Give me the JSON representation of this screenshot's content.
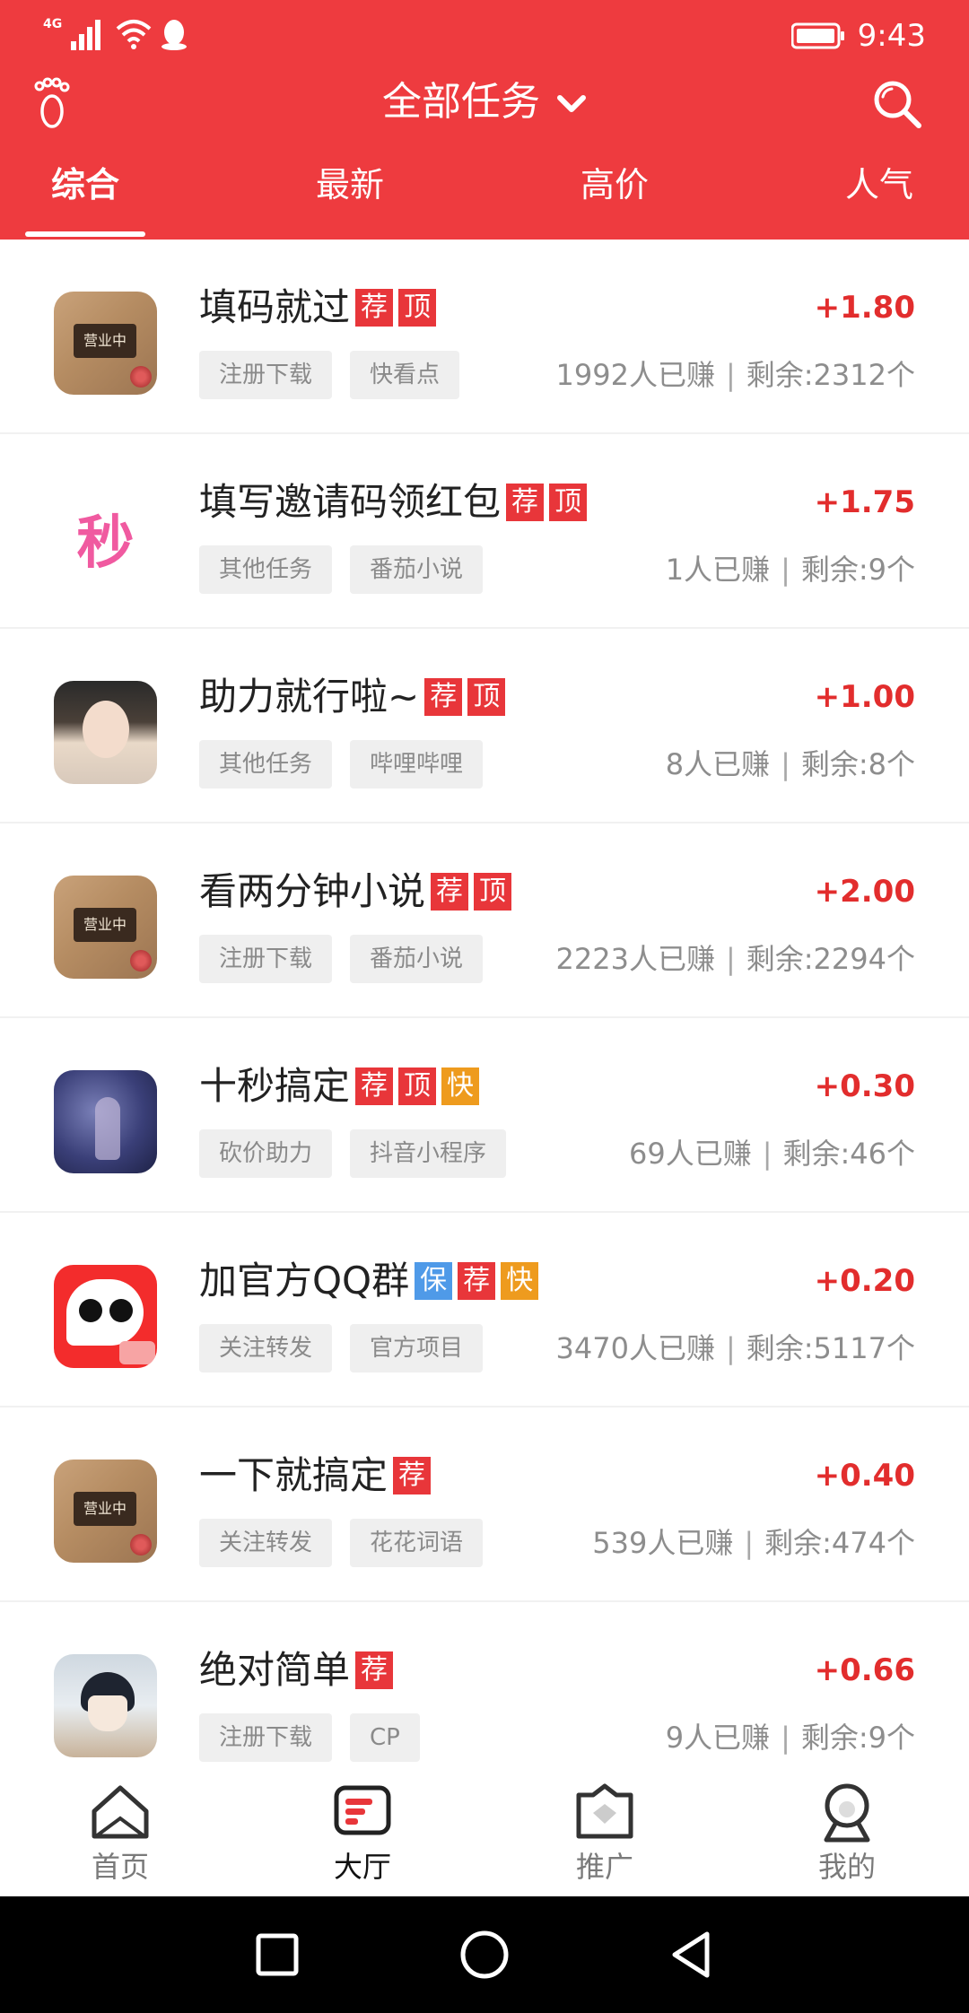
{
  "status_bar": {
    "network": "4G",
    "time": "9:43"
  },
  "header": {
    "title": "全部任务"
  },
  "tabs": [
    {
      "label": "综合",
      "active": true
    },
    {
      "label": "最新",
      "active": false
    },
    {
      "label": "高价",
      "active": false
    },
    {
      "label": "人气",
      "active": false
    }
  ],
  "tasks": [
    {
      "title": "填码就过",
      "badges": [
        "荐",
        "顶"
      ],
      "tags": [
        "注册下载",
        "快看点"
      ],
      "reward": "+1.80",
      "earned": "1992人已赚",
      "remaining": "剩余:2312个",
      "avatar_sign": "营业中"
    },
    {
      "title": "填写邀请码领红包",
      "badges": [
        "荐",
        "顶"
      ],
      "tags": [
        "其他任务",
        "番茄小说"
      ],
      "reward": "+1.75",
      "earned": "1人已赚",
      "remaining": "剩余:9个",
      "avatar_text": "秒"
    },
    {
      "title": "助力就行啦~",
      "badges": [
        "荐",
        "顶"
      ],
      "tags": [
        "其他任务",
        "哔哩哔哩"
      ],
      "reward": "+1.00",
      "earned": "8人已赚",
      "remaining": "剩余:8个"
    },
    {
      "title": "看两分钟小说",
      "badges": [
        "荐",
        "顶"
      ],
      "tags": [
        "注册下载",
        "番茄小说"
      ],
      "reward": "+2.00",
      "earned": "2223人已赚",
      "remaining": "剩余:2294个",
      "avatar_sign": "营业中"
    },
    {
      "title": "十秒搞定",
      "badges": [
        "荐",
        "顶",
        "快"
      ],
      "tags": [
        "砍价助力",
        "抖音小程序"
      ],
      "reward": "+0.30",
      "earned": "69人已赚",
      "remaining": "剩余:46个"
    },
    {
      "title": "加官方QQ群",
      "badges": [
        "保",
        "荐",
        "快"
      ],
      "tags": [
        "关注转发",
        "官方项目"
      ],
      "reward": "+0.20",
      "earned": "3470人已赚",
      "remaining": "剩余:5117个"
    },
    {
      "title": "一下就搞定",
      "badges": [
        "荐"
      ],
      "tags": [
        "关注转发",
        "花花词语"
      ],
      "reward": "+0.40",
      "earned": "539人已赚",
      "remaining": "剩余:474个",
      "avatar_sign": "营业中"
    },
    {
      "title": "绝对简单",
      "badges": [
        "荐"
      ],
      "tags": [
        "注册下载",
        "CP"
      ],
      "reward": "+0.66",
      "earned": "9人已赚",
      "remaining": "剩余:9个"
    }
  ],
  "bottom_nav": [
    {
      "label": "首页",
      "icon": "home-icon",
      "active": false
    },
    {
      "label": "大厅",
      "icon": "hall-icon",
      "active": true
    },
    {
      "label": "推广",
      "icon": "promote-icon",
      "active": false
    },
    {
      "label": "我的",
      "icon": "profile-icon",
      "active": false
    }
  ],
  "colors": {
    "primary_red": "#ee3b3f",
    "reward_red": "#e22d2d",
    "badge_orange": "#ee9b1e",
    "badge_blue": "#4f9ae8"
  }
}
